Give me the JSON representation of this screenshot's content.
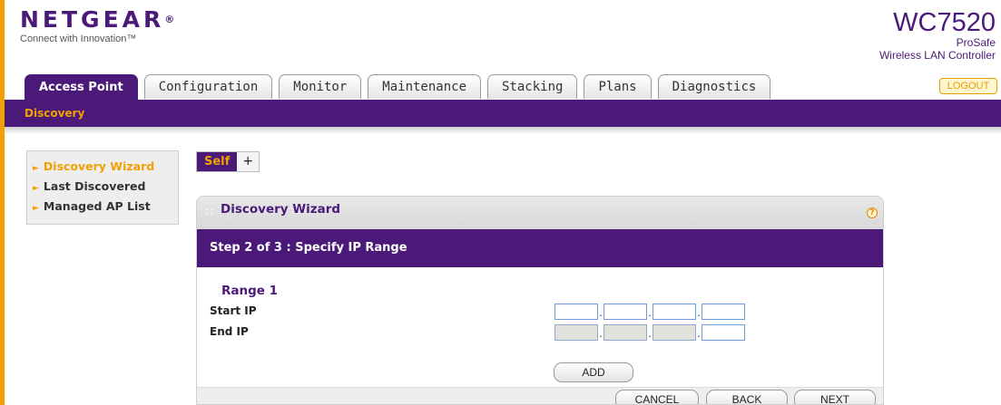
{
  "brand": {
    "logo_text": "NETGEAR",
    "logo_mark": "®",
    "tagline": "Connect with Innovation™",
    "model": "WC7520",
    "product_line1": "ProSafe",
    "product_line2": "Wireless LAN Controller"
  },
  "logout_label": "LOGOUT",
  "tabs": [
    {
      "label": "Access Point",
      "active": true
    },
    {
      "label": "Configuration",
      "active": false
    },
    {
      "label": "Monitor",
      "active": false
    },
    {
      "label": "Maintenance",
      "active": false
    },
    {
      "label": "Stacking",
      "active": false
    },
    {
      "label": "Plans",
      "active": false
    },
    {
      "label": "Diagnostics",
      "active": false
    }
  ],
  "subnav_label": "Discovery",
  "sidebar": {
    "items": [
      {
        "label": "Discovery Wizard",
        "active": true
      },
      {
        "label": "Last Discovered",
        "active": false
      },
      {
        "label": "Managed AP List",
        "active": false
      }
    ]
  },
  "subtabs": {
    "self_label": "Self",
    "add_label": "+"
  },
  "panel": {
    "title": "Discovery Wizard",
    "help_symbol": "?",
    "step_title": "Step 2 of 3 : Specify IP Range",
    "range_title": "Range 1",
    "start_label": "Start IP",
    "end_label": "End IP",
    "start_ip": [
      "",
      "",
      "",
      ""
    ],
    "end_ip": [
      "",
      "",
      "",
      ""
    ],
    "separator": "."
  },
  "buttons": {
    "add": "ADD",
    "cancel": "CANCEL",
    "back": "BACK",
    "next": "NEXT"
  },
  "colors": {
    "brand_purple": "#4b1a78",
    "accent_orange": "#f2a000"
  }
}
